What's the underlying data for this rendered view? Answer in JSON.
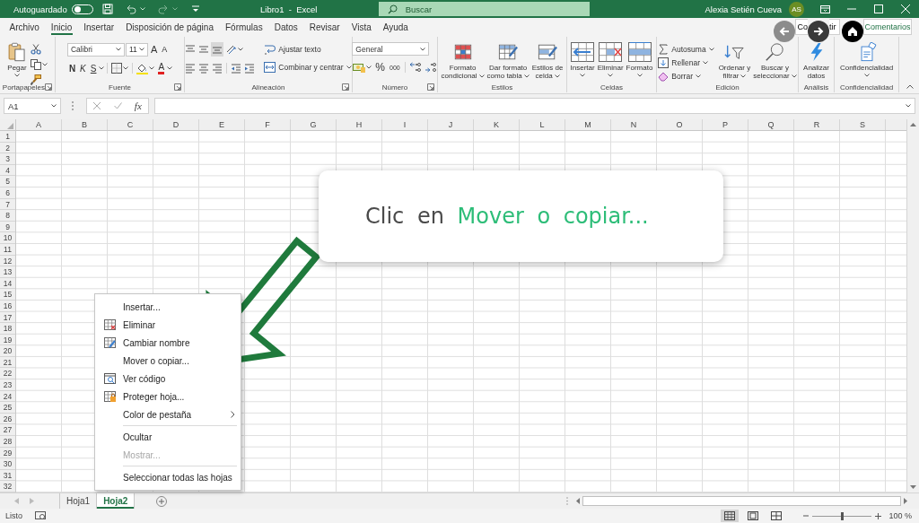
{
  "title_bar": {
    "autosave_label": "Autoguardado",
    "autosave_on": false,
    "title": "Libro1  -  Excel",
    "search_placeholder": "Buscar",
    "user_name": "Alexia Setién Cueva",
    "user_initials": "AS"
  },
  "ribbon_tabs": [
    {
      "label": "Archivo",
      "selected": false
    },
    {
      "label": "Inicio",
      "selected": true
    },
    {
      "label": "Insertar",
      "selected": false
    },
    {
      "label": "Disposición de página",
      "selected": false
    },
    {
      "label": "Fórmulas",
      "selected": false
    },
    {
      "label": "Datos",
      "selected": false
    },
    {
      "label": "Revisar",
      "selected": false
    },
    {
      "label": "Vista",
      "selected": false
    },
    {
      "label": "Ayuda",
      "selected": false
    }
  ],
  "share_button_parts": [
    "Co",
    "tir"
  ],
  "comments_button": "Comentarios",
  "ribbon_groups": [
    {
      "label": "Portapapeles",
      "launcher": true,
      "paste": "Pegar"
    },
    {
      "label": "Fuente",
      "launcher": true,
      "font_name": "Calibri",
      "font_size": "11",
      "grow": "A",
      "shrink": "A",
      "bold": "N",
      "italic": "K",
      "underline": "S",
      "font_color": "A"
    },
    {
      "label": "Alineación",
      "launcher": true,
      "vertical_align": [
        {
          "selected": false
        },
        {
          "selected": false
        },
        {
          "selected": true
        }
      ],
      "wrap_text": "Ajustar texto",
      "merge_center": "Combinar y centrar"
    },
    {
      "label": "Número",
      "launcher": true,
      "format": "General",
      "percent": "%",
      "thousands": "000"
    },
    {
      "label": "Estilos",
      "launcher": false,
      "buttons": [
        {
          "lines": [
            "Formato",
            "condicional"
          ],
          "dropdown": true
        },
        {
          "lines": [
            "Dar formato",
            "como tabla"
          ],
          "dropdown": true
        },
        {
          "lines": [
            "Estilos de",
            "celda"
          ],
          "dropdown": true
        }
      ]
    },
    {
      "label": "Celdas",
      "launcher": false,
      "buttons": [
        {
          "lines": [
            "Insertar"
          ],
          "dropdown": true
        },
        {
          "lines": [
            "Eliminar"
          ],
          "dropdown": true
        },
        {
          "lines": [
            "Formato"
          ],
          "dropdown": true
        }
      ]
    },
    {
      "label": "Edición",
      "launcher": false,
      "small_buttons": [
        {
          "label": "Autosuma",
          "dropdown": true
        },
        {
          "label": "Rellenar",
          "dropdown": true
        },
        {
          "label": "Borrar",
          "dropdown": true
        }
      ],
      "buttons": [
        {
          "lines": [
            "Ordenar y",
            "filtrar"
          ],
          "dropdown": true
        },
        {
          "lines": [
            "Buscar y",
            "seleccionar"
          ],
          "dropdown": true
        }
      ]
    },
    {
      "label": "Análisis",
      "launcher": false,
      "buttons": [
        {
          "lines": [
            "Analizar",
            "datos"
          ],
          "dropdown": false
        }
      ]
    },
    {
      "label": "Confidencialidad",
      "launcher": false,
      "buttons": [
        {
          "lines": [
            "Confidencialidad"
          ],
          "dropdown": true
        }
      ]
    }
  ],
  "formula_bar": {
    "name_box": "A1",
    "function_label": "fx"
  },
  "sheet": {
    "columns": [
      "A",
      "B",
      "C",
      "D",
      "E",
      "F",
      "G",
      "H",
      "I",
      "J",
      "K",
      "L",
      "M",
      "N",
      "O",
      "P",
      "Q",
      "R",
      "S"
    ],
    "rows": [
      "1",
      "2",
      "3",
      "4",
      "5",
      "6",
      "7",
      "8",
      "9",
      "10",
      "11",
      "12",
      "13",
      "14",
      "15",
      "16",
      "17",
      "18",
      "19",
      "20",
      "21",
      "22",
      "23",
      "24",
      "25",
      "26",
      "27",
      "28",
      "29",
      "30",
      "31",
      "32"
    ]
  },
  "sheet_tabs": [
    {
      "label": "Hoja1",
      "selected": false
    },
    {
      "label": "Hoja2",
      "selected": true
    }
  ],
  "status_bar": {
    "text": "Listo",
    "views": [
      {
        "selected": true
      },
      {
        "selected": false
      },
      {
        "selected": false
      }
    ],
    "zoom": {
      "level": 0.5
    },
    "zoom_label": "100 %"
  },
  "context_menu": [
    {
      "label": "Insertar...",
      "has_icon": false,
      "disabled": false,
      "submenu": false,
      "separator_before": false
    },
    {
      "label": "Eliminar",
      "has_icon": true,
      "disabled": false,
      "submenu": false,
      "separator_before": false
    },
    {
      "label": "Cambiar nombre",
      "has_icon": true,
      "disabled": false,
      "submenu": false,
      "separator_before": false
    },
    {
      "label": "Mover o copiar...",
      "has_icon": false,
      "disabled": false,
      "submenu": false,
      "separator_before": false
    },
    {
      "label": "Ver código",
      "has_icon": true,
      "disabled": false,
      "submenu": false,
      "separator_before": false
    },
    {
      "label": "Proteger hoja...",
      "has_icon": true,
      "disabled": false,
      "submenu": false,
      "separator_before": false
    },
    {
      "label": "Color de pestaña",
      "has_icon": false,
      "disabled": false,
      "submenu": true,
      "separator_before": false
    },
    {
      "label": "Ocultar",
      "has_icon": false,
      "disabled": false,
      "submenu": false,
      "separator_before": true
    },
    {
      "label": "Mostrar...",
      "has_icon": false,
      "disabled": true,
      "submenu": false,
      "separator_before": false
    },
    {
      "label": "Seleccionar todas las hojas",
      "has_icon": false,
      "disabled": false,
      "submenu": false,
      "separator_before": true
    }
  ],
  "callout": {
    "text": "Clic en",
    "highlight": "Mover o copiar..."
  }
}
